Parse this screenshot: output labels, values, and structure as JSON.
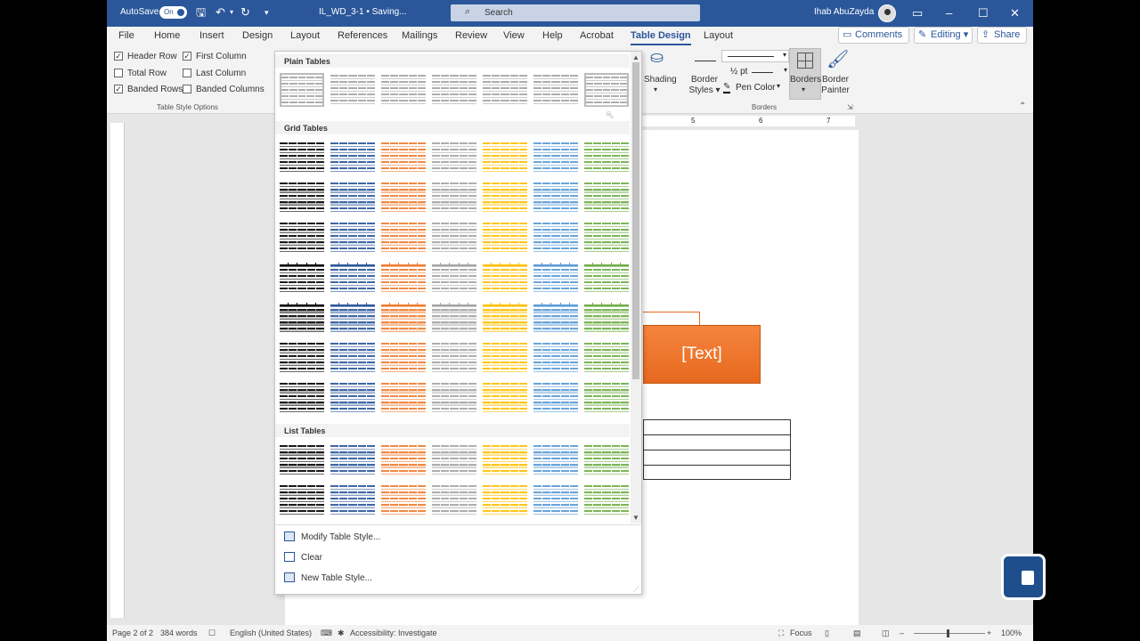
{
  "titlebar": {
    "autosave_label": "AutoSave",
    "autosave_state": "On",
    "document": "IL_WD_3-1 • Saving...",
    "search_placeholder": "Search",
    "user": "Ihab AbuZayda"
  },
  "menu": {
    "tabs": [
      "File",
      "Home",
      "Insert",
      "Design",
      "Layout",
      "References",
      "Mailings",
      "Review",
      "View",
      "Help",
      "Acrobat",
      "Table Design",
      "Layout"
    ],
    "active": "Table Design",
    "comments": "Comments",
    "editing": "Editing",
    "share": "Share"
  },
  "ribbon": {
    "options": {
      "header_row": "Header Row",
      "first_column": "First Column",
      "total_row": "Total Row",
      "last_column": "Last Column",
      "banded_rows": "Banded Rows",
      "banded_columns": "Banded Columns",
      "group_label": "Table Style Options"
    },
    "shading": "Shading",
    "border_styles_1": "Border",
    "border_styles_2": "Styles",
    "pen_weight": "½ pt",
    "pen_color": "Pen Color",
    "borders": "Borders",
    "border_painter_1": "Border",
    "border_painter_2": "Painter",
    "borders_group": "Borders"
  },
  "gallery": {
    "plain_tables": "Plain Tables",
    "grid_tables": "Grid Tables",
    "list_tables": "List Tables",
    "modify": "Modify Table Style...",
    "clear": "Clear",
    "new_style": "New Table Style..."
  },
  "document": {
    "smartart_text": "[Text]",
    "ruler_5": "5",
    "ruler_6": "6",
    "ruler_7": "7"
  },
  "status": {
    "page": "Page 2 of 2",
    "words": "384 words",
    "language": "English (United States)",
    "accessibility": "Accessibility: Investigate",
    "focus": "Focus",
    "zoom": "100%"
  },
  "colors": {
    "accent": "#2b579a",
    "orange": "#ed7d31",
    "gray": "#a5a5a5",
    "gold": "#ffc000",
    "lightblue": "#5b9bd5",
    "green": "#70ad47",
    "black": "#000000"
  }
}
